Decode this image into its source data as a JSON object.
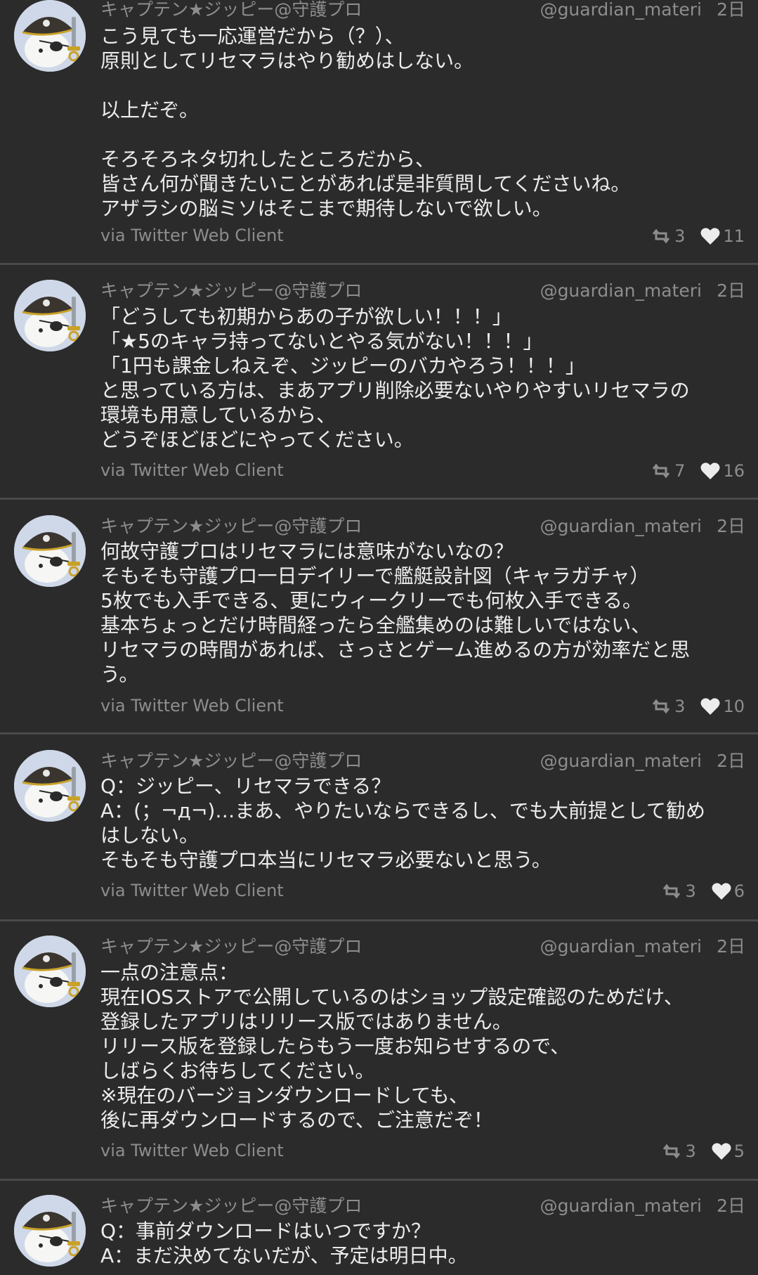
{
  "tweets": [
    {
      "author": "キャプテン★ジッピー@守護プロ",
      "handle": "@guardian_materi",
      "time": "2日",
      "lines": [
        "こう見ても一応運営だから（？）、",
        "原則としてリセマラはやり勧めはしない。",
        "",
        "以上だぞ。",
        "",
        "そろそろネタ切れしたところだから、",
        "皆さん何が聞きたいことがあれば是非質問してくださいね。",
        "アザラシの脳ミソはそこまで期待しないで欲しい。"
      ],
      "source": "via Twitter Web Client",
      "retweets": "3",
      "likes": "11"
    },
    {
      "author": "キャプテン★ジッピー@守護プロ",
      "handle": "@guardian_materi",
      "time": "2日",
      "lines": [
        "「どうしても初期からあの子が欲しい！！！」",
        "「★5のキャラ持ってないとやる気がない！！！」",
        "「1円も課金しねえぞ、ジッピーのバカやろう！！！」",
        "と思っている方は、まあアプリ削除必要ないやりやすいリセマラの",
        "環境も用意しているから、",
        "どうぞほどほどにやってください。"
      ],
      "source": "via Twitter Web Client",
      "retweets": "7",
      "likes": "16"
    },
    {
      "author": "キャプテン★ジッピー@守護プロ",
      "handle": "@guardian_materi",
      "time": "2日",
      "lines": [
        "何故守護プロはリセマラには意味がないなの？",
        "そもそも守護プロ一日デイリーで艦艇設計図（キャラガチャ）",
        "5枚でも入手できる、更にウィークリーでも何枚入手できる。",
        "基本ちょっとだけ時間経ったら全艦集めのは難しいではない、",
        "リセマラの時間があれば、さっさとゲーム進めるの方が効率だと思",
        "う。"
      ],
      "source": "via Twitter Web Client",
      "retweets": "3",
      "likes": "10"
    },
    {
      "author": "キャプテン★ジッピー@守護プロ",
      "handle": "@guardian_materi",
      "time": "2日",
      "lines": [
        "Q：ジッピー、リセマラできる？",
        "A：(；¬д¬)…まあ、やりたいならできるし、でも大前提として勧め",
        "はしない。",
        "そもそも守護プロ本当にリセマラ必要ないと思う。"
      ],
      "source": "via Twitter Web Client",
      "retweets": "3",
      "likes": "6"
    },
    {
      "author": "キャプテン★ジッピー@守護プロ",
      "handle": "@guardian_materi",
      "time": "2日",
      "lines": [
        "一点の注意点：",
        "現在IOSストアで公開しているのはショップ設定確認のためだけ、",
        "登録したアプリはリリース版ではありません。",
        "リリース版を登録したらもう一度お知らせするので、",
        "しばらくお待ちしてください。",
        "※現在のバージョンダウンロードしても、",
        "後に再ダウンロードするので、ご注意だぞ！"
      ],
      "source": "via Twitter Web Client",
      "retweets": "3",
      "likes": "5"
    },
    {
      "author": "キャプテン★ジッピー@守護プロ",
      "handle": "@guardian_materi",
      "time": "2日",
      "lines": [
        "Q：事前ダウンロードはいつですか？",
        "A：まだ決めてないだが、予定は明日中。"
      ],
      "source": "",
      "retweets": "",
      "likes": ""
    }
  ],
  "icons": {
    "avatar": "pirate-seal-avatar-icon",
    "retweet": "retweet-icon",
    "like": "heart-icon"
  },
  "colors": {
    "background": "#2b2b2b",
    "divider": "#4a4a4a",
    "text": "#ececec",
    "muted": "#8d8d8d"
  }
}
